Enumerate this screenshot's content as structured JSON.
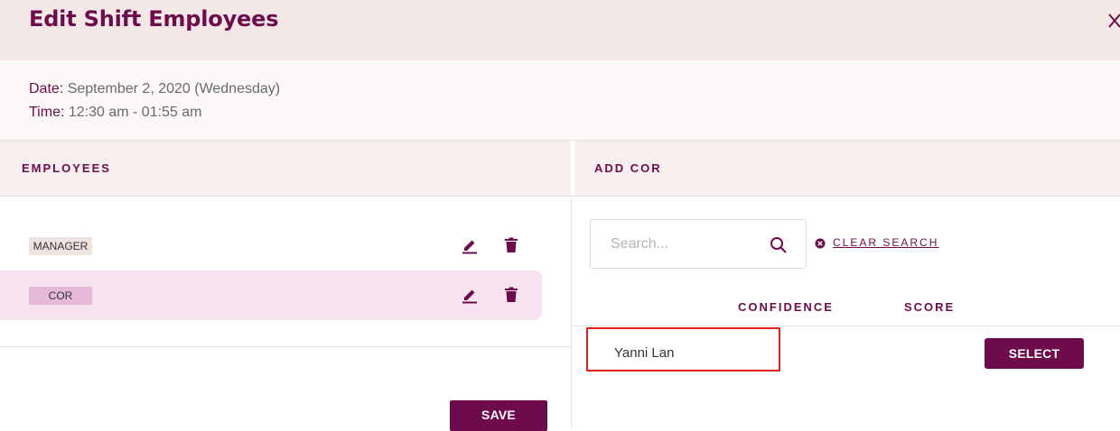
{
  "dialog": {
    "title": "Edit Shift Employees",
    "close_icon": "close-icon"
  },
  "shift": {
    "date_label": "Date:",
    "date_value": "September 2, 2020 (Wednesday)",
    "time_label": "Time:",
    "time_value": "12:30 am - 01:55 am"
  },
  "employees": {
    "header": "EMPLOYEES",
    "rows": [
      {
        "role": "MANAGER",
        "selected": false
      },
      {
        "role": "COR",
        "selected": true
      }
    ],
    "edit_icon": "edit-pencil-icon",
    "delete_icon": "trash-icon",
    "save_label": "SAVE"
  },
  "add_cor": {
    "header": "ADD COR",
    "search_placeholder": "Search...",
    "search_value": "",
    "clear_search_label": "CLEAR SEARCH",
    "columns": [
      "CONFIDENCE",
      "SCORE"
    ],
    "results": [
      {
        "name": "Yanni Lan",
        "action_label": "SELECT"
      }
    ]
  },
  "colors": {
    "brand": "#6e0b4c",
    "header_bg": "#f3e8e6",
    "selected_row": "#f6e3ef",
    "highlight": "#e0201b"
  }
}
